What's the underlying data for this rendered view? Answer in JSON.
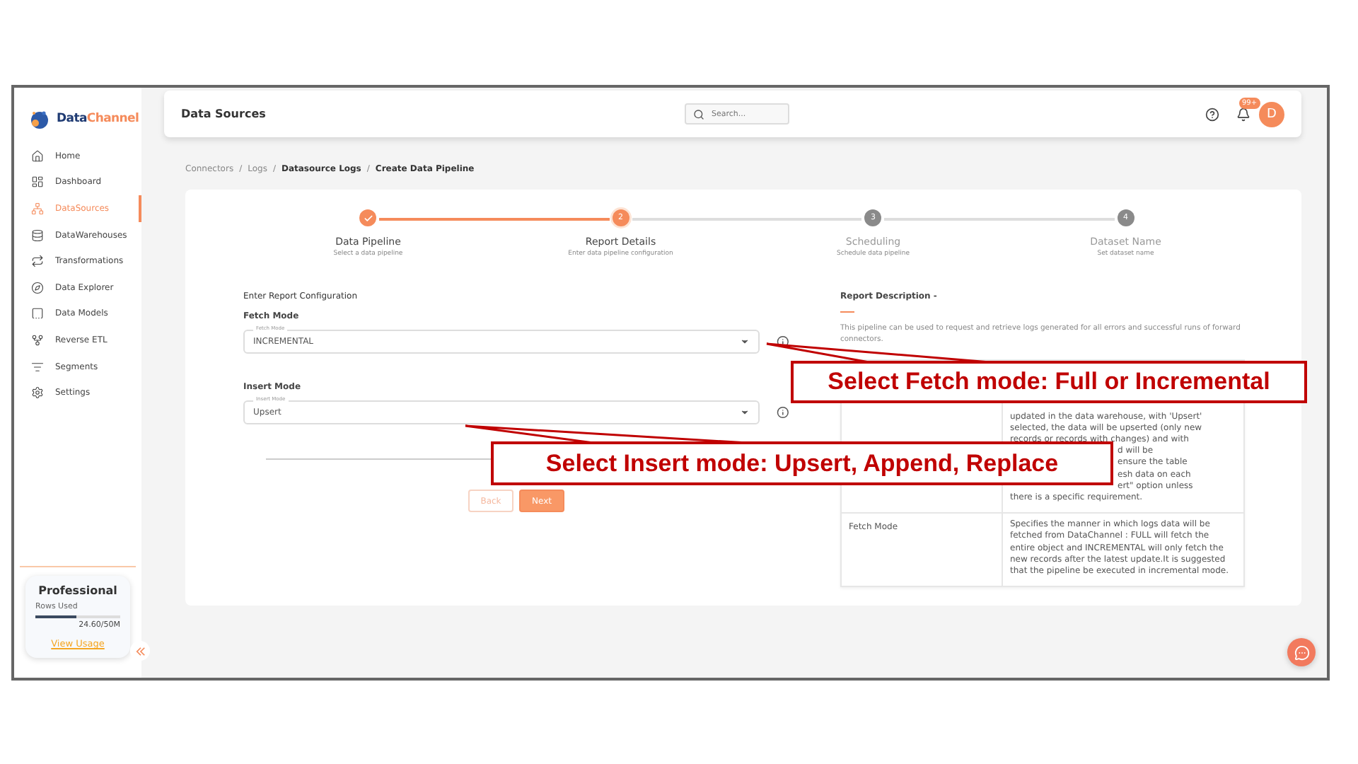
{
  "header": {
    "title": "Data Sources",
    "search": {
      "placeholder": "Search..."
    },
    "notification_badge": "99+",
    "avatar_initial": "D"
  },
  "sidebar": {
    "logo": {
      "part1": "Data",
      "part2": "Channel"
    },
    "items": [
      {
        "label": "Home",
        "selected": false
      },
      {
        "label": "Dashboard",
        "selected": false
      },
      {
        "label": "DataSources",
        "selected": true
      },
      {
        "label": "DataWarehouses",
        "selected": false
      },
      {
        "label": "Transformations",
        "selected": false
      },
      {
        "label": "Data Explorer",
        "selected": false
      },
      {
        "label": "Data Models",
        "selected": false
      },
      {
        "label": "Reverse ETL",
        "selected": false
      },
      {
        "label": "Segments",
        "selected": false
      },
      {
        "label": "Settings",
        "selected": false
      }
    ],
    "plan": {
      "name": "Professional",
      "label": "Rows Used",
      "level": 0.49,
      "reading": "24.60/50M",
      "link": "View Usage"
    }
  },
  "breadcrumb": {
    "separator": "/",
    "items": [
      {
        "label": "Connectors",
        "emphasized": false
      },
      {
        "label": "Logs",
        "emphasized": false
      },
      {
        "label": "Datasource Logs",
        "emphasized": true
      },
      {
        "label": "Create Data Pipeline",
        "emphasized": true
      }
    ]
  },
  "stepper": [
    {
      "completed": true,
      "current": false,
      "title": "Data Pipeline",
      "subtitle": "Select a data pipeline"
    },
    {
      "number": "2",
      "completed": false,
      "current": true,
      "title": "Report Details",
      "subtitle": "Enter data pipeline configuration"
    },
    {
      "number": "3",
      "completed": false,
      "current": false,
      "title": "Scheduling",
      "subtitle": "Schedule data pipeline"
    },
    {
      "number": "4",
      "completed": false,
      "current": false,
      "title": "Dataset Name",
      "subtitle": "Set dataset name"
    }
  ],
  "form": {
    "title": "Enter Report Configuration",
    "fields": [
      {
        "label": "Fetch Mode",
        "floating_label": "Fetch Mode",
        "value": "INCREMENTAL"
      },
      {
        "label": "Insert Mode",
        "floating_label": "Insert Mode",
        "value": "Upsert"
      }
    ],
    "buttons": [
      {
        "label": "Back",
        "kind": "secondary"
      },
      {
        "label": "Next",
        "kind": "primary"
      }
    ]
  },
  "description": {
    "title": "Report Description -",
    "text": "This pipeline can be used to request and retrieve logs generated for all errors and successful runs of forward connectors.",
    "rows": [
      {
        "lines": [
          {
            "text": "updated in the data warehouse, with 'Upsert'",
            "kind": "full"
          },
          {
            "text": "selected, the data will be upserted (only new",
            "kind": "full"
          },
          {
            "text": "records or records with changes) and with",
            "kind": "full"
          },
          {
            "text": "d will be",
            "kind": "partial"
          },
          {
            "text": "ensure the table",
            "kind": "partial"
          },
          {
            "text": "esh data on each",
            "kind": "partial"
          },
          {
            "text": "ert\" option unless",
            "kind": "partial"
          },
          {
            "text": "there is a specific requirement.",
            "kind": "full"
          }
        ]
      },
      {
        "parameter": "Fetch Mode",
        "lines": [
          {
            "text": "Specifies the manner in which logs data will be fetched from DataChannel : FULL will fetch the entire object and INCREMENTAL will only fetch the new records after the latest update.It is suggested that the pipeline be executed in incremental mode.",
            "kind": "full"
          }
        ]
      }
    ]
  },
  "callouts": [
    {
      "text": "Select Fetch mode: Full or Incremental"
    },
    {
      "text": "Select Insert mode: Upsert, Append, Replace"
    }
  ]
}
